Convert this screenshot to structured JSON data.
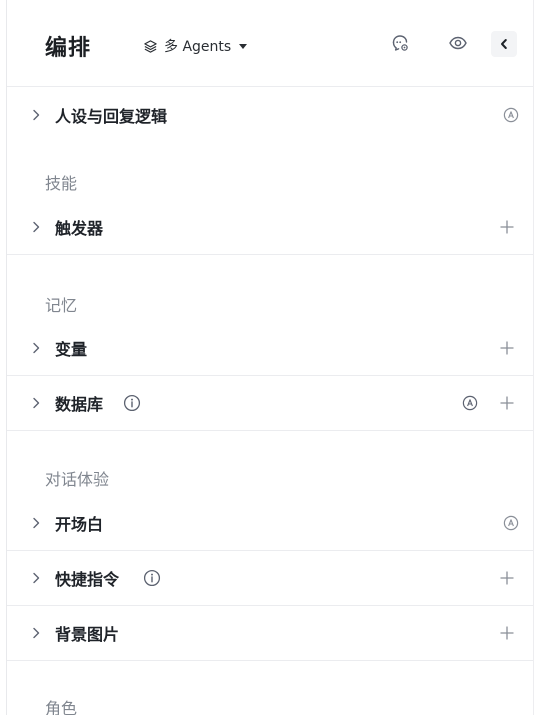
{
  "header": {
    "title": "编排",
    "mode_label": "多 Agents"
  },
  "sections": {
    "persona": {
      "label": "人设与回复逻辑"
    },
    "skills": {
      "heading": "技能",
      "trigger": "触发器"
    },
    "memory": {
      "heading": "记忆",
      "variables": "变量",
      "database": "数据库"
    },
    "dialog": {
      "heading": "对话体验",
      "opening": "开场白",
      "shortcuts": "快捷指令",
      "background": "背景图片"
    },
    "role": {
      "heading": "角色"
    }
  },
  "colors": {
    "text_primary": "#1f2329",
    "text_secondary": "#80868f",
    "icon_gray": "#8a8f98",
    "divider": "#ebecef"
  }
}
